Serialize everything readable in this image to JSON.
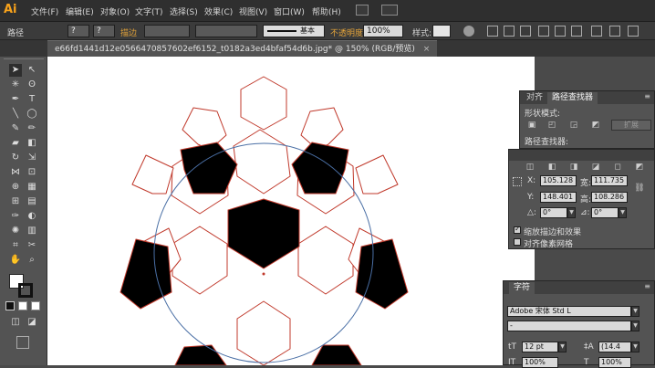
{
  "app": {
    "logo": "Ai"
  },
  "menu": {
    "items": [
      "文件(F)",
      "编辑(E)",
      "对象(O)",
      "文字(T)",
      "选择(S)",
      "效果(C)",
      "视图(V)",
      "窗口(W)",
      "帮助(H)"
    ]
  },
  "control": {
    "selection_label": "路径",
    "fill_swatch": "?",
    "stroke_swatch": "?",
    "stroke_label": "描边",
    "brush_value": "基本",
    "opacity_label": "不透明度",
    "opacity_value": "100%",
    "style_label": "样式:"
  },
  "document": {
    "tab_title": "e66fd1441d12e0566470857602ef6152_t0182a3ed4bfaf54d6b.jpg* @ 150% (RGB/预览)"
  },
  "pathfinder_panel": {
    "tabs": [
      "对齐",
      "路径查找器"
    ],
    "shape_modes_label": "形状模式:",
    "expand_label": "扩展",
    "pathfinders_label": "路径查找器:"
  },
  "transform_panel": {
    "x_label": "X:",
    "x_value": "105.128",
    "w_label": "宽:",
    "w_value": "111.735",
    "y_label": "Y:",
    "y_value": "148.401",
    "h_label": "高:",
    "h_value": "108.286",
    "angle_label": "△:",
    "angle_value": "0°",
    "shear_label": "⊿:",
    "shear_value": "0°",
    "scale_strokes_label": "缩放描边和效果",
    "align_pixel_label": "对齐像素网格"
  },
  "character_panel": {
    "tab": "字符",
    "font_family": "Adobe 宋体 Std L",
    "font_style": "-",
    "font_size": "12 pt",
    "leading": "(14.4",
    "horiz_scale": "100%",
    "vert_scale": "100%"
  },
  "colors": {
    "accent": "#f7a21b",
    "highlight": "#e3a33a",
    "path": "#c0392b",
    "guide": "#4a6fa5"
  }
}
